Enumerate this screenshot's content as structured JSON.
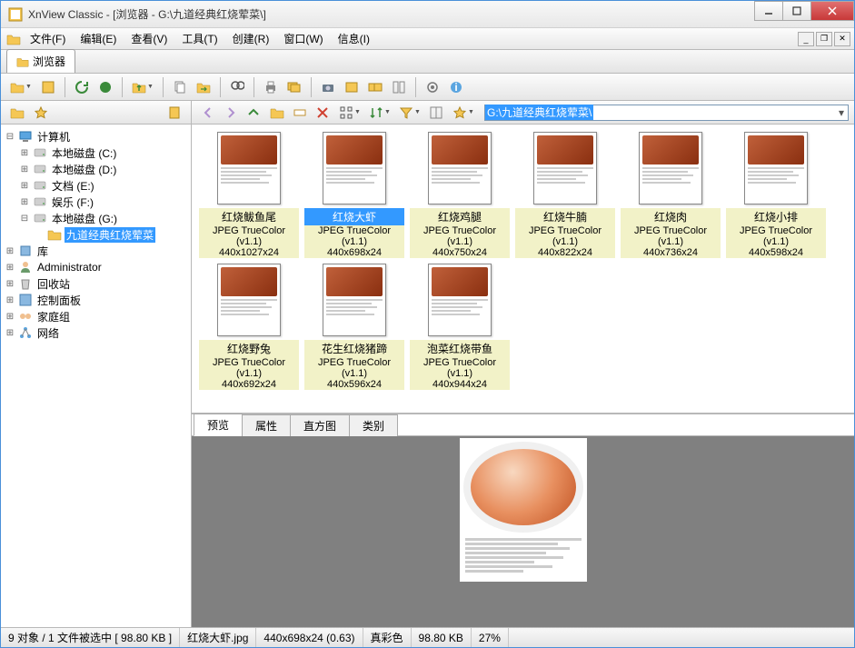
{
  "title": "XnView Classic - [浏览器 - G:\\九道经典红烧荤菜\\]",
  "menus": [
    "文件(F)",
    "编辑(E)",
    "查看(V)",
    "工具(T)",
    "创建(R)",
    "窗口(W)",
    "信息(I)"
  ],
  "browser_tab": "浏览器",
  "address": "G:\\九道经典红烧荤菜\\",
  "tree": {
    "root": "计算机",
    "drives": [
      {
        "label": "本地磁盘 (C:)"
      },
      {
        "label": "本地磁盘 (D:)"
      },
      {
        "label": "文档 (E:)"
      },
      {
        "label": "娱乐 (F:)"
      },
      {
        "label": "本地磁盘 (G:)",
        "expanded": true,
        "children": [
          {
            "label": "九道经典红烧荤菜",
            "selected": true
          }
        ]
      }
    ],
    "others": [
      "库",
      "Administrator",
      "回收站",
      "控制面板",
      "家庭组",
      "网络"
    ]
  },
  "thumb_meta": "JPEG TrueColor (v1.1)",
  "thumbs": [
    {
      "name": "红烧鲅鱼尾",
      "dim": "440x1027x24"
    },
    {
      "name": "红烧大虾",
      "dim": "440x698x24",
      "selected": true
    },
    {
      "name": "红烧鸡腿",
      "dim": "440x750x24"
    },
    {
      "name": "红烧牛腩",
      "dim": "440x822x24"
    },
    {
      "name": "红烧肉",
      "dim": "440x736x24"
    },
    {
      "name": "红烧小排",
      "dim": "440x598x24"
    },
    {
      "name": "红烧野兔",
      "dim": "440x692x24"
    },
    {
      "name": "花生红烧猪蹄",
      "dim": "440x596x24"
    },
    {
      "name": "泡菜红烧带鱼",
      "dim": "440x944x24"
    }
  ],
  "preview_tabs": [
    "预览",
    "属性",
    "直方图",
    "类别"
  ],
  "status": {
    "summary": "9 对象 / 1 文件被选中  [ 98.80 KB ]",
    "filename": "红烧大虾.jpg",
    "dim": "440x698x24 (0.63)",
    "colormode": "真彩色",
    "size": "98.80 KB",
    "zoom": "27%"
  }
}
